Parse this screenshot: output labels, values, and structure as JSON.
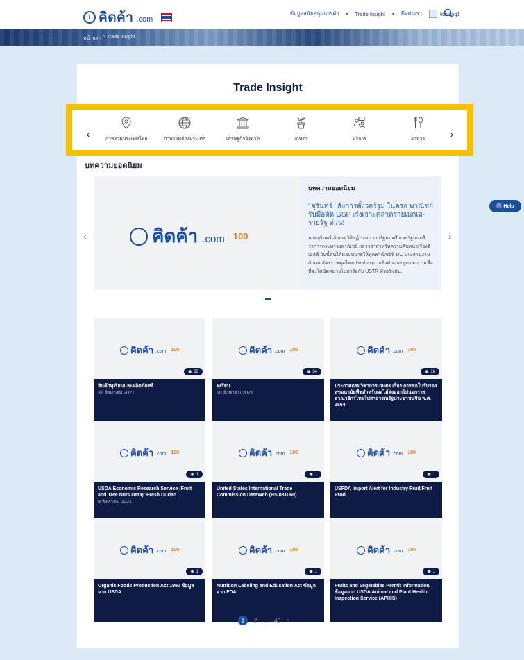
{
  "header": {
    "logo_text": "คิดค้า",
    "logo_suffix": ".com",
    "nav": [
      "ข้อมูลสนับสนุนการค้า",
      "Trade Insight",
      "ติดต่อเรา"
    ],
    "user_name": "training1"
  },
  "breadcrumb": {
    "home": "หน้าแรก",
    "separator": ">",
    "current": "Trade Insight"
  },
  "page": {
    "title": "Trade Insight"
  },
  "categories": [
    {
      "label": "ภาพรวมประเทศไทย",
      "icon": "location-pin-icon"
    },
    {
      "label": "ภาพรวมต่างประเทศ",
      "icon": "globe-icon"
    },
    {
      "label": "เศรษฐกิจจังหวัด",
      "icon": "government-building-icon"
    },
    {
      "label": "เกษตร",
      "icon": "plant-pot-icon"
    },
    {
      "label": "บริการ",
      "icon": "service-people-icon"
    },
    {
      "label": "อาหาร",
      "icon": "fork-spoon-icon"
    }
  ],
  "popular": {
    "section_label": "บทความยอดนิยม",
    "kicker": "บทความยอดนิยม",
    "headline": "' จุรินทร์ ' สั่งการตั้งวอร์รูม ในครอ.พาณิชย์ รับมือตัด GSP เร่งเจาะตลาดรายเมกเล-รายรัฐ ด่วน!",
    "body": "นายจุรินทร์ ลักษณวิศิษฏ์ รองนายกรัฐมนตรี และรัฐมนตรีว่าการกระทรวงพาณิชย์ กล่าวว่าสำหรับความคืบหน้าเรื่องจีเอสพี วันนี้ตนได้มอบหมายให้ทูตพาณิชย์ที่ DC ประสานงานกับเอกอัครราชทูตไทยประจำกรุงวอชิงตันและทูตแรงงานเพื่อที่จะได้นัดหมายไปหารือกับ USTR ทั่วอชิงตัน."
  },
  "tile_brand": {
    "text": "คิดค้า",
    "suffix": ".com",
    "badge": "100"
  },
  "articles": [
    {
      "title": "สินค้าทุเรียนและผลิตภัณฑ์",
      "date": "31 สิงหาคม 2021",
      "views": "32"
    },
    {
      "title": "ทุเรียน",
      "date": "10 สิงหาคม 2021",
      "views": "34"
    },
    {
      "title": "ประกาศกรมวิชาการเกษตร เรื่อง การขอใบรับรองสุขอนามัยพืชสำหรับผลไม้ส่งออกไปนอกราชอาณาจักรไทยไปสาธารณรัฐประชาชนจีน พ.ศ. 2564",
      "date": "",
      "views": "16"
    },
    {
      "title": "USDA Economic Research Service (Fruit and Tree Nuts Data): Fresh Durian",
      "date": "9 สิงหาคม 2021",
      "views": "1"
    },
    {
      "title": "United States International Trade Commission DataWeb (HS 081060)",
      "date": "",
      "views": "1"
    },
    {
      "title": "USFDA Import Alert for Industry Fruit/Fruit Prod",
      "date": "",
      "views": "1"
    },
    {
      "title": "Organic Foods Production Act 1990 ข้อมูลจาก USDA",
      "date": "",
      "views": "1"
    },
    {
      "title": "Nutrition Labeling and Education Act ข้อมูลจาก FDA",
      "date": "",
      "views": "1"
    },
    {
      "title": "Fruits and Vegetables Permit Information ข้อมูลจาก USDA Animal and Plant Health Inspection Service (APHIS)",
      "date": "",
      "views": "1"
    }
  ],
  "pagination": {
    "current": "1",
    "next_page": "2",
    "ellipsis": "...",
    "last": "40"
  },
  "help": {
    "label": "Help"
  },
  "colors": {
    "primary": "#1d4e9e",
    "highlight": "#f7c000",
    "tile_footer": "#0e1b45",
    "background": "#dce9f7"
  }
}
